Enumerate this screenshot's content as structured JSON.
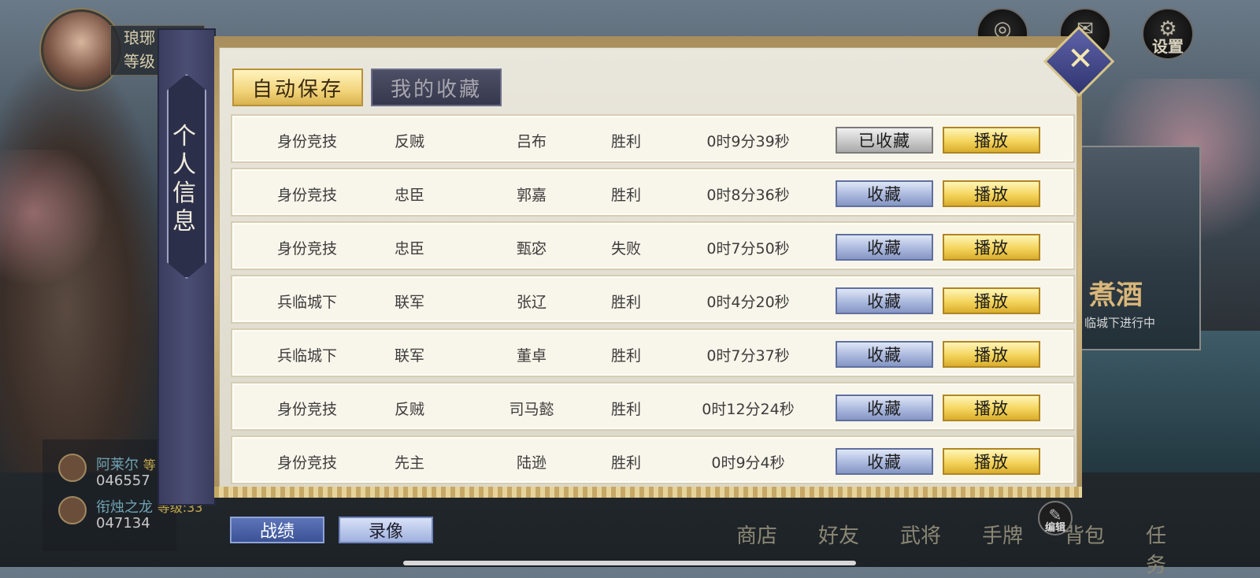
{
  "player": {
    "name": "琅琊",
    "level_label": "等级"
  },
  "top_icons": [
    {
      "label": "",
      "icon": "lantern-icon"
    },
    {
      "label": "件",
      "icon": "mail-icon"
    },
    {
      "label": "设置",
      "icon": "settings-icon"
    }
  ],
  "side_panel": {
    "label": "个人信息"
  },
  "tabs": {
    "active": "自动保存",
    "inactive": "我的收藏"
  },
  "columns": [
    "mode",
    "role",
    "hero",
    "result",
    "duration"
  ],
  "records": [
    {
      "mode": "身份竞技",
      "role": "反贼",
      "hero": "吕布",
      "result": "胜利",
      "duration": "0时9分39秒",
      "fav_label": "已收藏",
      "favorited": true,
      "play_label": "播放"
    },
    {
      "mode": "身份竞技",
      "role": "忠臣",
      "hero": "郭嘉",
      "result": "胜利",
      "duration": "0时8分36秒",
      "fav_label": "收藏",
      "favorited": false,
      "play_label": "播放"
    },
    {
      "mode": "身份竞技",
      "role": "忠臣",
      "hero": "甄宓",
      "result": "失败",
      "duration": "0时7分50秒",
      "fav_label": "收藏",
      "favorited": false,
      "play_label": "播放"
    },
    {
      "mode": "兵临城下",
      "role": "联军",
      "hero": "张辽",
      "result": "胜利",
      "duration": "0时4分20秒",
      "fav_label": "收藏",
      "favorited": false,
      "play_label": "播放"
    },
    {
      "mode": "兵临城下",
      "role": "联军",
      "hero": "董卓",
      "result": "胜利",
      "duration": "0时7分37秒",
      "fav_label": "收藏",
      "favorited": false,
      "play_label": "播放"
    },
    {
      "mode": "身份竞技",
      "role": "反贼",
      "hero": "司马懿",
      "result": "胜利",
      "duration": "0时12分24秒",
      "fav_label": "收藏",
      "favorited": false,
      "play_label": "播放"
    },
    {
      "mode": "身份竞技",
      "role": "先主",
      "hero": "陆逊",
      "result": "胜利",
      "duration": "0时9分4秒",
      "fav_label": "收藏",
      "favorited": false,
      "play_label": "播放"
    }
  ],
  "bottom_tabs": {
    "stats": "战绩",
    "video": "录像"
  },
  "promo": {
    "title": "煮酒",
    "subtitle": "临城下进行中"
  },
  "chat": [
    {
      "name": "阿莱尔",
      "level": "等",
      "id": "046557"
    },
    {
      "name": "衔烛之龙",
      "level": "等级:33",
      "id": "047134"
    }
  ],
  "bottom_nav": [
    "商店",
    "好友",
    "武将",
    "手牌",
    "背包",
    "任务"
  ],
  "edit_label": "编辑",
  "close_icon": "close-icon"
}
